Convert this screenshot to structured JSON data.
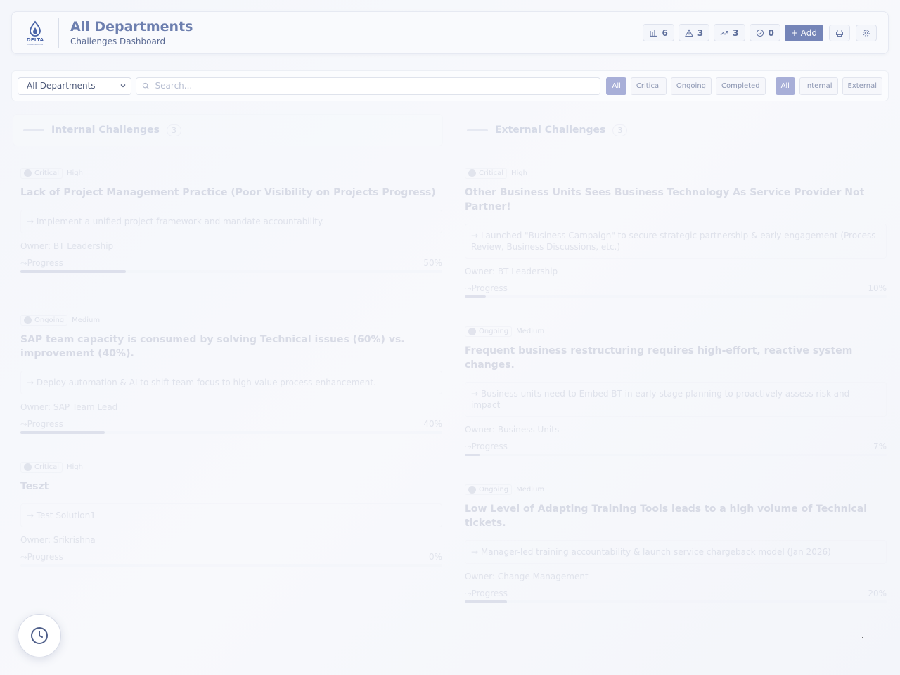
{
  "header": {
    "logo_brand": "DELTA",
    "logo_sub": "CORPORATION",
    "title": "All Departments",
    "subtitle": "Challenges Dashboard",
    "stats": [
      {
        "icon": "bar-chart-icon",
        "value": "6"
      },
      {
        "icon": "alert-triangle-icon",
        "value": "3"
      },
      {
        "icon": "trending-up-icon",
        "value": "3"
      },
      {
        "icon": "check-circle-icon",
        "value": "0"
      }
    ],
    "add_label": "+ Add"
  },
  "filters": {
    "department_selected": "All Departments",
    "search_placeholder": "Search...",
    "status_chips": [
      "All",
      "Critical",
      "Ongoing",
      "Completed"
    ],
    "type_chips": [
      "All",
      "Internal",
      "External"
    ]
  },
  "columns": {
    "internal": {
      "title": "Internal Challenges",
      "count": "3"
    },
    "external": {
      "title": "External Challenges",
      "count": "3"
    }
  },
  "internal_cards": [
    {
      "status": "Critical",
      "priority": "High",
      "title": "Lack of Project Management Practice (Poor Visibility on Projects Progress)",
      "solution": "→ Implement a unified project framework and mandate accountability.",
      "owner": "Owner: BT Leadership",
      "progress_label": "Progress",
      "progress_text": "50%",
      "progress": 25
    },
    {
      "status": "Ongoing",
      "priority": "Medium",
      "title": "SAP team capacity is consumed by solving Technical issues (60%) vs. improvement (40%).",
      "solution": "→ Deploy automation & AI to shift team focus to high-value process enhancement.",
      "owner": "Owner: SAP Team Lead",
      "progress_label": "Progress",
      "progress_text": "40%",
      "progress": 20
    },
    {
      "status": "Critical",
      "priority": "High",
      "title": "Teszt",
      "solution": "→ Test Solution1",
      "owner": "Owner: Srikrishna",
      "progress_label": "Progress",
      "progress_text": "0%",
      "progress": 0
    }
  ],
  "external_cards": [
    {
      "status": "Critical",
      "priority": "High",
      "title": "Other Business Units Sees Business Technology As Service Provider Not Partner!",
      "solution": "→ Launched \"Business Campaign\" to secure strategic partnership & early engagement (Process Review, Business Discussions, etc.)",
      "owner": "Owner: BT Leadership",
      "progress_label": "Progress",
      "progress_text": "10%",
      "progress": 5
    },
    {
      "status": "Ongoing",
      "priority": "Medium",
      "title": "Frequent business restructuring requires high-effort, reactive system changes.",
      "solution": "→ Business units need to Embed BT in early-stage planning to proactively assess risk and impact",
      "owner": "Owner: Business Units",
      "progress_label": "Progress",
      "progress_text": "7%",
      "progress": 3.5
    },
    {
      "status": "Ongoing",
      "priority": "Medium",
      "title": "Low Level of Adapting Training Tools leads to a high volume of Technical tickets.",
      "solution": "→ Manager-led training accountability & launch service chargeback model (Jan 2026)",
      "owner": "Owner: Change Management",
      "progress_label": "Progress",
      "progress_text": "20%",
      "progress": 10
    }
  ]
}
